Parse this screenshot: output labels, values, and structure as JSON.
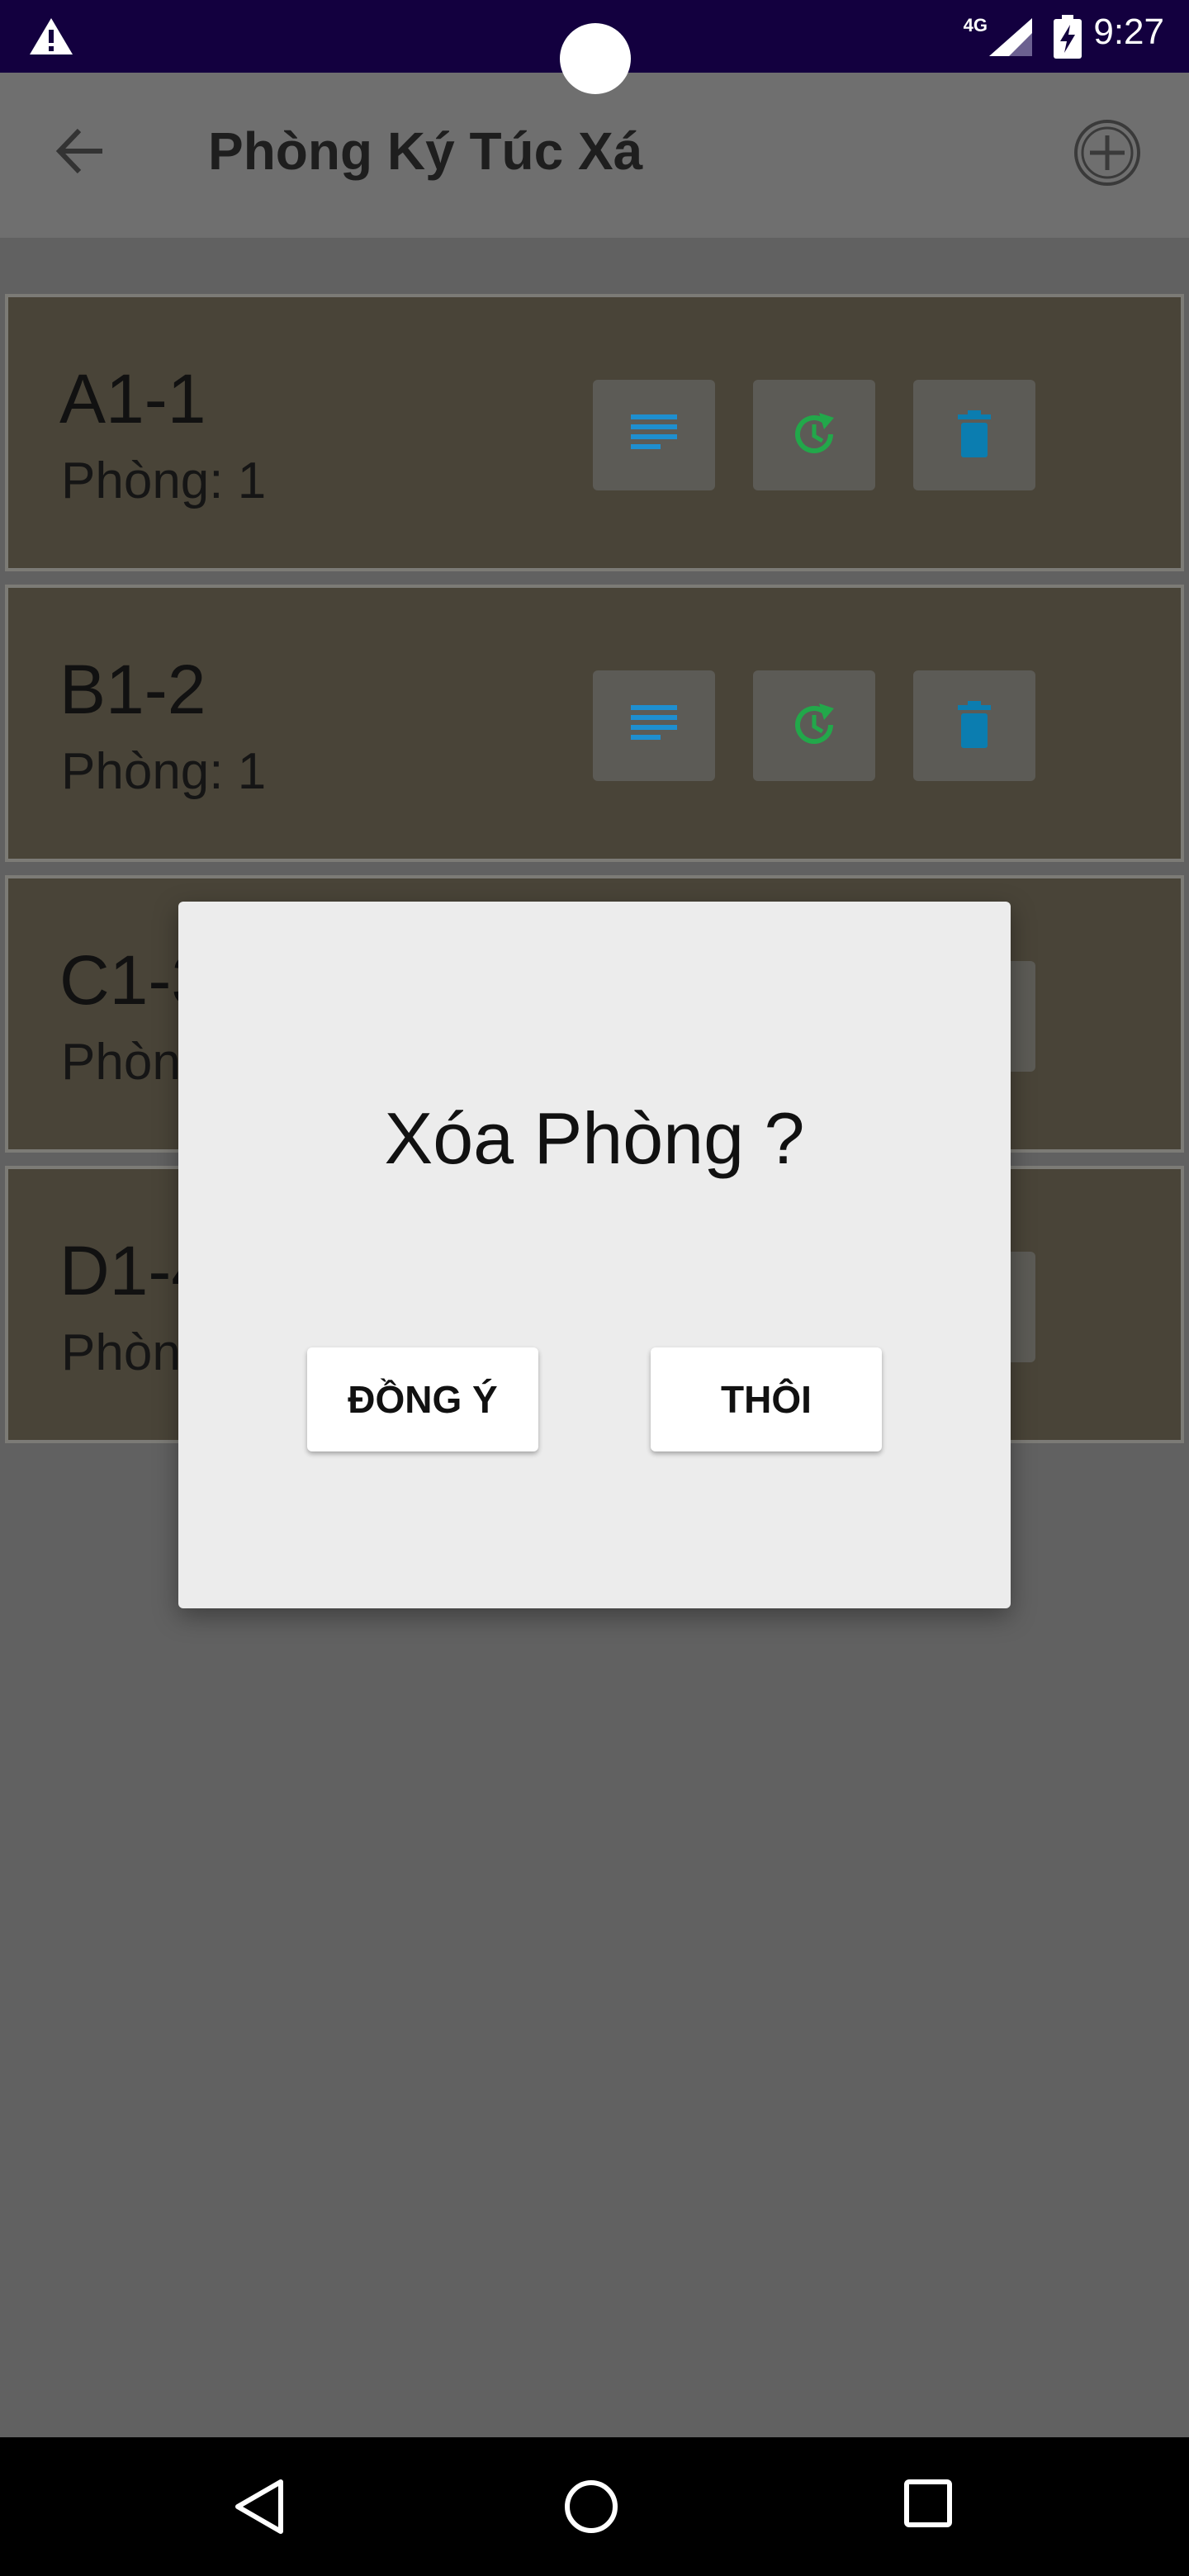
{
  "status_bar": {
    "network": "4G",
    "time": "9:27",
    "icons": [
      "warning-icon",
      "signal-icon",
      "battery-charging-icon"
    ]
  },
  "app_bar": {
    "title": "Phòng Ký Túc Xá",
    "back_icon": "arrow-back-icon",
    "add_icon": "add-circle-icon"
  },
  "rooms": [
    {
      "name": "A1-1",
      "sub": "Phòng: 1"
    },
    {
      "name": "B1-2",
      "sub": "Phòng: 1"
    },
    {
      "name": "C1-3",
      "sub": "Phòng: 1"
    },
    {
      "name": "D1-4",
      "sub": "Phòng: 1"
    }
  ],
  "room_actions": [
    "details-icon",
    "refresh-icon",
    "delete-icon"
  ],
  "dialog": {
    "title": "Xóa Phòng ?",
    "confirm_label": "ĐỒNG Ý",
    "cancel_label": "THÔI"
  },
  "colors": {
    "status_bar": "#13003f",
    "list_item": "#494438",
    "details_icon": "#1e8fd0",
    "refresh_icon": "#22a84a",
    "delete_icon": "#0b7db0",
    "dialog_bg": "#ececec"
  }
}
